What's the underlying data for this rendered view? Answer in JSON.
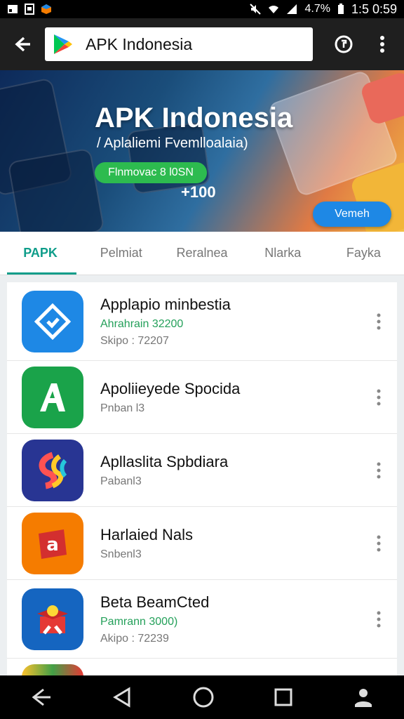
{
  "status": {
    "battery": "4.7%",
    "time": "1:5 0:59"
  },
  "appbar": {
    "search_title": "APK Indonesia"
  },
  "banner": {
    "title": "APK Indonesia",
    "subtitle": "/ Aplaliemi Fvemlloalaia)",
    "pill": "Flnmovac 8 l0SN",
    "count": "+100",
    "button": "Vemeh"
  },
  "tabs": [
    "PAPK",
    "Pelmiat",
    "Reralnea",
    "Nlarka",
    "Fayka"
  ],
  "list": [
    {
      "title": "Applapio minbestia",
      "line2": "Ahrahrain 32200",
      "line2_green": true,
      "line3": "Skipo : 72207",
      "icon": "blue-diamond-icon",
      "color": "#1e88e5"
    },
    {
      "title": "Apoliieyede Spocida",
      "line2": "Pnban l3",
      "line2_green": false,
      "line3": "",
      "icon": "green-a-icon",
      "color": "#1aa34a"
    },
    {
      "title": "Apllaslita Spbdiara",
      "line2": "Pabanl3",
      "line2_green": false,
      "line3": "",
      "icon": "multicolor-s-icon",
      "color": "#283593"
    },
    {
      "title": "Harlaied Nals",
      "line2": "Snbenl3",
      "line2_green": false,
      "line3": "",
      "icon": "red-box-icon",
      "color": "#f57c00"
    },
    {
      "title": "Beta BeamCted",
      "line2": "Pamrann 3000)",
      "line2_green": true,
      "line3": "Akipo : 72239",
      "icon": "gift-box-icon",
      "color": "#1565c0"
    }
  ]
}
